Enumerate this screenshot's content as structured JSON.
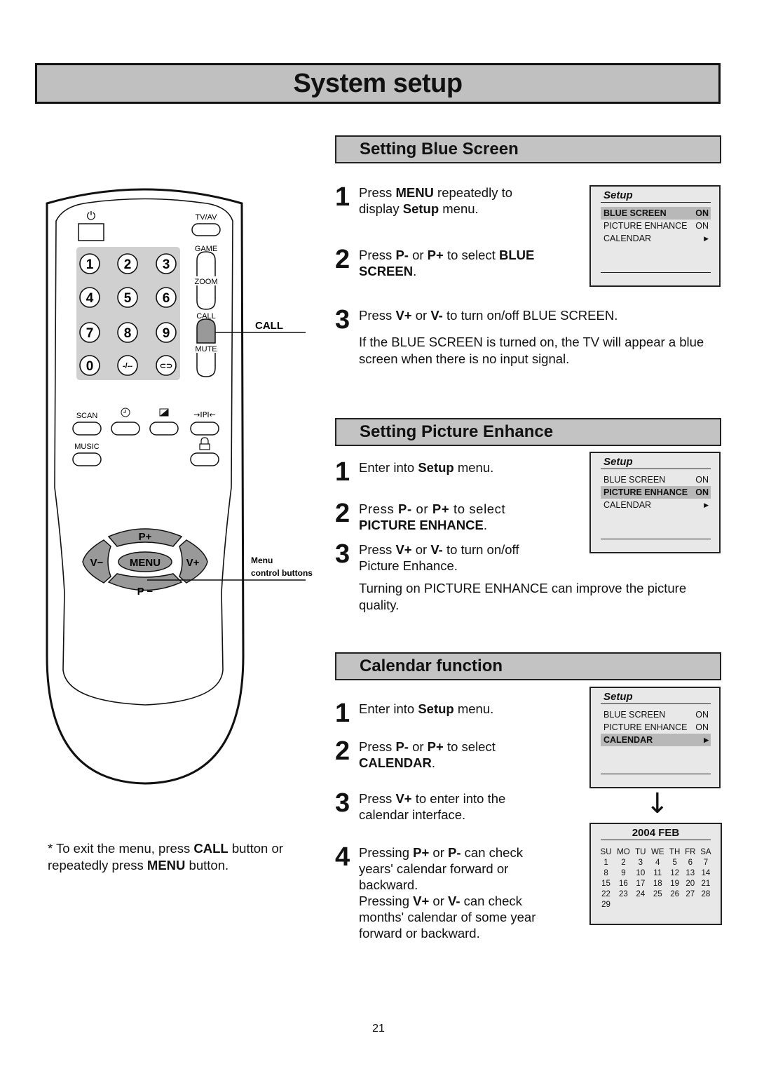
{
  "page": {
    "title": "System setup",
    "page_number": "21"
  },
  "remote": {
    "labels": {
      "power": "power-icon",
      "tvav": "TV/AV",
      "game": "GAME",
      "zoom": "ZOOM",
      "call": "CALL",
      "mute": "MUTE",
      "scan": "SCAN",
      "music": "MUSIC",
      "pip": "→IPI←"
    },
    "digits": [
      "1",
      "2",
      "3",
      "4",
      "5",
      "6",
      "7",
      "8",
      "9",
      "0",
      "-/--",
      "⊂⊃"
    ],
    "nav": {
      "p_plus": "P+",
      "p_minus": "P −",
      "v_minus": "V−",
      "v_plus": "V+",
      "menu": "MENU"
    },
    "callouts": {
      "call": "CALL",
      "menu_line1": "Menu",
      "menu_line2": "control buttons"
    },
    "footnote": {
      "pre": "* To exit the menu, press ",
      "b1": "CALL",
      "mid": " button or repeatedly press ",
      "b2": "MENU",
      "post": " button."
    }
  },
  "sections": {
    "blue_screen": {
      "heading": "Setting Blue Screen",
      "step1": {
        "num": "1",
        "a": "Press ",
        "b": "MENU",
        "c": " repeatedly to display ",
        "d": "Setup",
        "e": " menu."
      },
      "step2": {
        "num": "2",
        "a": "Press ",
        "b": "P-",
        "c": " or ",
        "d": "P+",
        "e": " to select ",
        "f": "BLUE SCREEN",
        "g": "."
      },
      "step3": {
        "num": "3",
        "a": "Press ",
        "b": "V+",
        "c": " or ",
        "d": "V-",
        "e": " to turn on/off BLUE SCREEN."
      },
      "note": "If the BLUE SCREEN is turned on, the TV will appear a blue screen when there is no input signal.",
      "osd": {
        "title": "Setup",
        "rows": [
          {
            "label": "BLUE SCREEN",
            "value": "ON"
          },
          {
            "label": "PICTURE ENHANCE",
            "value": "ON"
          },
          {
            "label": "CALENDAR",
            "value": "▶"
          }
        ],
        "selected": 0
      }
    },
    "picture_enhance": {
      "heading": "Setting Picture Enhance",
      "step1": {
        "num": "1",
        "a": "Enter into ",
        "b": "Setup",
        "c": " menu."
      },
      "step2": {
        "num": "2",
        "a": "Press ",
        "b": "P-",
        "c": " or ",
        "d": "P+",
        "e": " to select ",
        "f": "PICTURE ENHANCE",
        "g": "."
      },
      "step3": {
        "num": "3",
        "a": "Press ",
        "b": "V+",
        "c": " or ",
        "d": "V-",
        "e": " to turn on/off Picture Enhance."
      },
      "note": "Turning on PICTURE ENHANCE can improve the picture quality.",
      "osd": {
        "title": "Setup",
        "rows": [
          {
            "label": "BLUE SCREEN",
            "value": "ON"
          },
          {
            "label": "PICTURE ENHANCE",
            "value": "ON"
          },
          {
            "label": "CALENDAR",
            "value": "▶"
          }
        ],
        "selected": 1
      }
    },
    "calendar": {
      "heading": "Calendar function",
      "step1": {
        "num": "1",
        "a": "Enter into ",
        "b": "Setup",
        "c": " menu."
      },
      "step2": {
        "num": "2",
        "a": "Press ",
        "b": "P-",
        "c": " or ",
        "d": "P+",
        "e": " to select ",
        "f": "CALENDAR",
        "g": "."
      },
      "step3": {
        "num": "3",
        "a": "Press ",
        "b": "V+",
        "c": " to enter into the calendar interface."
      },
      "step4": {
        "num": "4",
        "a": "Pressing ",
        "b": "P+",
        "c": " or ",
        "d": "P-",
        "e": " can check years' calendar forward or backward.",
        "f": "Pressing ",
        "g": "V+",
        "h": " or ",
        "i": "V-",
        "j": " can check months' calendar of some year forward or backward."
      },
      "osd": {
        "title": "Setup",
        "rows": [
          {
            "label": "BLUE SCREEN",
            "value": "ON"
          },
          {
            "label": "PICTURE ENHANCE",
            "value": "ON"
          },
          {
            "label": "CALENDAR",
            "value": "▶"
          }
        ],
        "selected": 2
      },
      "arrow": "↓",
      "calendar_view": {
        "title": "2004 FEB",
        "weekdays": [
          "SU",
          "MO",
          "TU",
          "WE",
          "TH",
          "FR",
          "SA"
        ],
        "weeks": [
          [
            "1",
            "2",
            "3",
            "4",
            "5",
            "6",
            "7"
          ],
          [
            "8",
            "9",
            "10",
            "11",
            "12",
            "13",
            "14"
          ],
          [
            "15",
            "16",
            "17",
            "18",
            "19",
            "20",
            "21"
          ],
          [
            "22",
            "23",
            "24",
            "25",
            "26",
            "27",
            "28"
          ],
          [
            "29",
            "",
            "",
            "",
            "",
            "",
            ""
          ]
        ]
      }
    }
  }
}
